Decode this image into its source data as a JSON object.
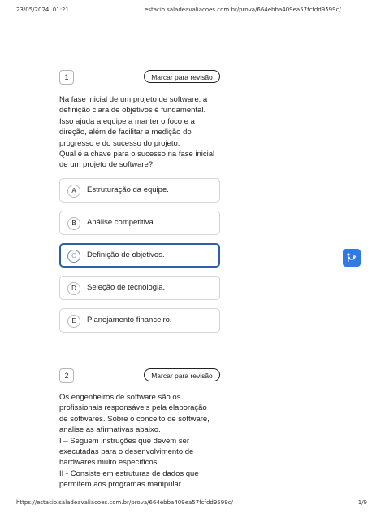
{
  "print_header": {
    "datetime": "23/05/2024, 01:21",
    "url": "estacio.saladeavaliacoes.com.br/prova/664ebba409ea57fcfdd9599c/"
  },
  "print_footer": {
    "url": "https://estacio.saladeavaliacoes.com.br/prova/664ebba409ea57fcfdd9599c/",
    "page": "1/9"
  },
  "questions": [
    {
      "number": "1",
      "review_label": "Marcar para revisão",
      "text": "Na fase inicial de um projeto de software, a\ndefinição clara de objetivos é fundamental.\nIsso ajuda a equipe a manter o foco e a\ndireção, além de facilitar a medição do\nprogresso e do sucesso do projeto.\nQual é a chave para o sucesso na fase inicial\nde um projeto de software?",
      "options": [
        {
          "letter": "A",
          "text": "Estruturação da equipe."
        },
        {
          "letter": "B",
          "text": "Análise competitiva."
        },
        {
          "letter": "C",
          "text": "Definição de objetivos."
        },
        {
          "letter": "D",
          "text": "Seleção de tecnologia."
        },
        {
          "letter": "E",
          "text": "Planejamento financeiro."
        }
      ],
      "selected": "C"
    },
    {
      "number": "2",
      "review_label": "Marcar para revisão",
      "text": "Os engenheiros de software são os\nprofissionais responsáveis pela elaboração\nde softwares. Sobre o conceito de software,\nanalise as afirmativas abaixo.\nI – Seguem instruções que devem ser\nexecutadas para o desenvolvimento de\nhardwares muito específicos.\nII - Consiste em estruturas de dados que\npermitem aos programas manipular"
    }
  ],
  "colors": {
    "selected_border": "#2f5fa8",
    "fab_background": "#2f7ae5"
  },
  "icons": {
    "fab": "accessibility-hand-icon"
  }
}
